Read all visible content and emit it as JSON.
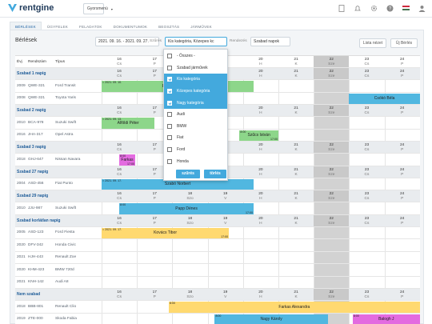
{
  "brand": {
    "name": "rentgine",
    "accent": "#43a9dd"
  },
  "topbar": {
    "quickmenu": "Gyorsmenü",
    "icons": [
      "document-icon",
      "bell-icon",
      "gear-icon",
      "help-icon",
      "flag-hu-icon",
      "user-icon"
    ]
  },
  "tabs": [
    "BÉRLÉSEK",
    "ÜGYFELEK",
    "FELADATOK",
    "DOKUMENTUMOK",
    "BEOSZTÁS",
    "JÁRMŰVEK"
  ],
  "toolbar": {
    "title": "Bérlések",
    "date_range": "2021. 09. 16. - 2021. 09. 27.",
    "filter_label": "Szűrés",
    "filter_value": "Kis kategória, Közepes kc",
    "sort_label": "Rendezés",
    "sort_value": "Szabad napok",
    "list_button": "Lista nézet",
    "new_button": "Új Bérlés"
  },
  "grid_header": {
    "year": "Évj",
    "plate": "Rendszám",
    "type": "Típus"
  },
  "days": [
    {
      "n": "16",
      "d": "Cs",
      "shade": false
    },
    {
      "n": "17",
      "d": "P",
      "shade": false
    },
    {
      "n": "18",
      "d": "Szo",
      "shade": false
    },
    {
      "n": "19",
      "d": "V",
      "shade": false
    },
    {
      "n": "20",
      "d": "H",
      "shade": false
    },
    {
      "n": "21",
      "d": "K",
      "shade": false
    },
    {
      "n": "22",
      "d": "Sze",
      "shade": true
    },
    {
      "n": "23",
      "d": "Cs",
      "shade": false
    },
    {
      "n": "24",
      "d": "P",
      "shade": false
    }
  ],
  "rows": [
    {
      "kind": "head"
    },
    {
      "kind": "group",
      "name": "Szabad 1 napig"
    },
    {
      "kind": "car",
      "year": "2009",
      "plate": "QWE-321",
      "model": "Ford Transit"
    },
    {
      "kind": "car",
      "year": "2008",
      "plate": "QWE-321",
      "model": "Toyota Yaris"
    },
    {
      "kind": "group",
      "name": "Szabad 2 napig"
    },
    {
      "kind": "car",
      "year": "2010",
      "plate": "BCA-978",
      "model": "Suzuki Swift"
    },
    {
      "kind": "car",
      "year": "2016",
      "plate": "JHA-317",
      "model": "Opel Astra"
    },
    {
      "kind": "group",
      "name": "Szabad 3 napig"
    },
    {
      "kind": "car",
      "year": "2018",
      "plate": "GHJ-647",
      "model": "Nissan Navara"
    },
    {
      "kind": "group",
      "name": "Szabad 27 napig"
    },
    {
      "kind": "car",
      "year": "2004",
      "plate": "ASD-456",
      "model": "Fiat Punto"
    },
    {
      "kind": "group",
      "name": "Szabad 29 napig"
    },
    {
      "kind": "car",
      "year": "2010",
      "plate": "JJU-987",
      "model": "Suzuki Swift"
    },
    {
      "kind": "group",
      "name": "Szabad korlátlan napig"
    },
    {
      "kind": "car",
      "year": "2005",
      "plate": "ASD-123",
      "model": "Ford Fiesta"
    },
    {
      "kind": "car",
      "year": "2020",
      "plate": "DFV-342",
      "model": "Honda Civic"
    },
    {
      "kind": "car",
      "year": "2021",
      "plate": "HJH-443",
      "model": "Renault Zoe"
    },
    {
      "kind": "car",
      "year": "2020",
      "plate": "KHM-423",
      "model": "BMW 720d"
    },
    {
      "kind": "car",
      "year": "2021",
      "plate": "KNH-142",
      "model": "Audi A8"
    },
    {
      "kind": "group",
      "name": "Nem szabad"
    },
    {
      "kind": "car",
      "year": "2018",
      "plate": "BBB-801",
      "model": "Renault Clio"
    },
    {
      "kind": "car",
      "year": "2019",
      "plate": "ZTE-000",
      "model": "Skoda Fabia"
    }
  ],
  "bookings": [
    {
      "name": "Farkas Alexandra",
      "start": "= 2021. 09. 10.",
      "end": "",
      "color": "green"
    },
    {
      "name": "Csókó Béla",
      "start": "",
      "end": "",
      "color": "blue"
    },
    {
      "name": "Alföldi Péter",
      "start": "= 2021. 09. 13.",
      "end": "",
      "color": "green"
    },
    {
      "name": "Szűcs István",
      "start": "8:00",
      "end": "17:00",
      "color": "green"
    },
    {
      "name": "Farkas",
      "start": "8:00",
      "end": "17:00",
      "color": "pink"
    },
    {
      "name": "Szabó Norbert",
      "start": "= 2021. 09. 17.",
      "end": "",
      "color": "blue"
    },
    {
      "name": "Papp Dénes",
      "start": "8:00",
      "end": "17:00",
      "color": "blue"
    },
    {
      "name": "Kovács Tibor",
      "start": "= 2021. 09. 17.",
      "end": "17:00",
      "color": "yellow"
    },
    {
      "name": "Farkas Alexandra",
      "start": "8:00",
      "end": "",
      "color": "yellow"
    },
    {
      "name": "Nagy Károly",
      "start": "8:00",
      "end": "",
      "color": "blue"
    },
    {
      "name": "Balogh J",
      "start": "8:00",
      "end": "",
      "color": "pink"
    }
  ],
  "dropdown": {
    "items": [
      {
        "label": "- Összes -",
        "checked": false
      },
      {
        "label": "Szabad járművek",
        "checked": false
      },
      {
        "label": "Kis kategória",
        "checked": true
      },
      {
        "label": "Közepes kategória",
        "checked": true
      },
      {
        "label": "Nagy kategória",
        "checked": true
      },
      {
        "label": "Audi",
        "checked": false
      },
      {
        "label": "BMW",
        "checked": false
      },
      {
        "label": "Fiat",
        "checked": false
      },
      {
        "label": "Ford",
        "checked": false
      },
      {
        "label": "Honda",
        "checked": false
      }
    ],
    "filter_btn": "szűrés",
    "clear_btn": "törlés"
  }
}
